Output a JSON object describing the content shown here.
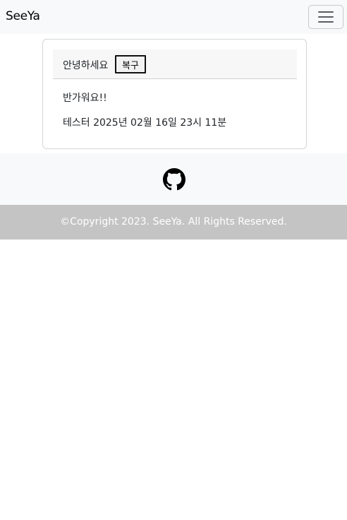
{
  "navbar": {
    "brand": "SeeYa",
    "menu_icon": "hamburger-menu-icon"
  },
  "card": {
    "greeting": "안녕하세요",
    "restore_label": "복구",
    "welcome": "반가워요!!",
    "info_line": "테스터 2025년 02월 16일 23시 11분"
  },
  "footer": {
    "github_icon": "github-icon",
    "copyright": "©Copyright 2023. SeeYa. All Rights Reserved."
  },
  "colors": {
    "navbar_bg": "#f8f9fa",
    "footer_bottom_bg": "#c4c4c4"
  }
}
